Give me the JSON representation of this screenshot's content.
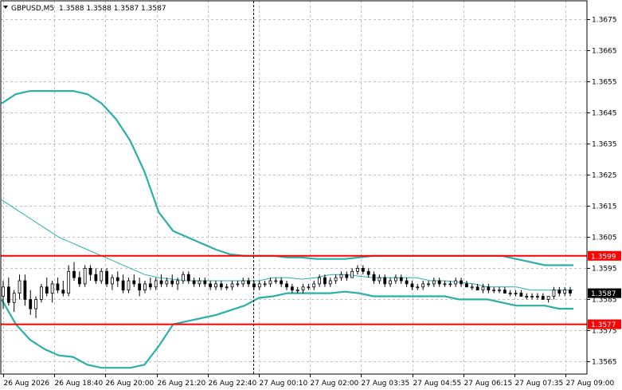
{
  "header": {
    "symbol": "GBPUSD,M5",
    "ohlc": "1.3588 1.3588 1.3587 1.3587",
    "menu_icon": "triangle-down-icon"
  },
  "colors": {
    "background": "#ffffff",
    "grid": "#c0c0c0",
    "band": "#2ab0a8",
    "middle": "#2ab0a8",
    "level": "#ff0000",
    "candle": "#000000",
    "price_tag": "#000000"
  },
  "chart_data": {
    "type": "candlestick",
    "title": "GBPUSD,M5",
    "y_ticks": [
      "1.3565",
      "1.3575",
      "1.3585",
      "1.3595",
      "1.3605",
      "1.3615",
      "1.3625",
      "1.3635",
      "1.3645",
      "1.3655",
      "1.3665",
      "1.3675"
    ],
    "ylim": [
      1.3561,
      1.3681
    ],
    "x_ticks": [
      "26 Aug 2026",
      "26 Aug 18:40",
      "26 Aug 20:00",
      "26 Aug 21:20",
      "26 Aug 22:40",
      "27 Aug 00:10",
      "27 Aug 02:00",
      "27 Aug 03:35",
      "27 Aug 04:55",
      "27 Aug 06:15",
      "27 Aug 07:35",
      "27 Aug 09:00"
    ],
    "grid": true,
    "horizontal_levels": [
      {
        "value": 1.3599,
        "label": "1.3599",
        "color": "#ff0000"
      },
      {
        "value": 1.3577,
        "label": "1.3577",
        "color": "#ff0000"
      }
    ],
    "current_price": {
      "value": 1.3587,
      "label": "1.3587"
    },
    "crosshair_x_fraction": 0.431,
    "upper_band": [
      1.3648,
      1.3651,
      1.3652,
      1.3652,
      1.3652,
      1.3652,
      1.3651,
      1.3648,
      1.3643,
      1.3636,
      1.3626,
      1.3613,
      1.3607,
      1.3605,
      1.3603,
      1.3601,
      1.35995,
      1.3599,
      1.3599,
      1.3599,
      1.35985,
      1.35985,
      1.3598,
      1.3598,
      1.3598,
      1.35985,
      1.3599,
      1.3599,
      1.3599,
      1.3599,
      1.3599,
      1.3599,
      1.3599,
      1.3599,
      1.3599,
      1.3599,
      1.3598,
      1.3597,
      1.3596,
      1.3596,
      1.3596
    ],
    "middle_band": [
      1.3617,
      1.3614,
      1.3611,
      1.3608,
      1.3605,
      1.3603,
      1.3601,
      1.3599,
      1.3597,
      1.3595,
      1.3593,
      1.3592,
      1.35915,
      1.3591,
      1.3591,
      1.3591,
      1.3591,
      1.3591,
      1.3591,
      1.3592,
      1.3592,
      1.35915,
      1.3592,
      1.3593,
      1.3593,
      1.35925,
      1.3592,
      1.3592,
      1.3592,
      1.3592,
      1.3591,
      1.3591,
      1.35905,
      1.359,
      1.3589,
      1.3589,
      1.3589,
      1.3588,
      1.3588,
      1.3588,
      1.3588
    ],
    "lower_band": [
      1.3585,
      1.3577,
      1.3572,
      1.3569,
      1.3567,
      1.35665,
      1.3564,
      1.3563,
      1.3563,
      1.3563,
      1.3564,
      1.357,
      1.3577,
      1.3578,
      1.3579,
      1.358,
      1.35815,
      1.3583,
      1.35855,
      1.3586,
      1.3587,
      1.3587,
      1.3587,
      1.3587,
      1.35875,
      1.3587,
      1.3586,
      1.3586,
      1.3586,
      1.3586,
      1.3586,
      1.3586,
      1.3585,
      1.3585,
      1.3585,
      1.3584,
      1.3583,
      1.3583,
      1.3583,
      1.3582,
      1.3582
    ],
    "candles": [
      [
        1.3586,
        1.3591,
        1.3582,
        1.3589
      ],
      [
        1.3589,
        1.3592,
        1.3583,
        1.3584
      ],
      [
        1.3584,
        1.3588,
        1.3581,
        1.3587
      ],
      [
        1.3587,
        1.3593,
        1.3585,
        1.3591
      ],
      [
        1.3591,
        1.3593,
        1.3583,
        1.3585
      ],
      [
        1.3585,
        1.3588,
        1.358,
        1.3582
      ],
      [
        1.3582,
        1.3586,
        1.3579,
        1.3585
      ],
      [
        1.3585,
        1.359,
        1.3584,
        1.3589
      ],
      [
        1.3589,
        1.3592,
        1.3586,
        1.3587
      ],
      [
        1.3587,
        1.3591,
        1.3584,
        1.359
      ],
      [
        1.359,
        1.3592,
        1.3587,
        1.3588
      ],
      [
        1.3588,
        1.3591,
        1.3586,
        1.3587
      ],
      [
        1.3587,
        1.3596,
        1.3586,
        1.3594
      ],
      [
        1.3594,
        1.3597,
        1.3591,
        1.3592
      ],
      [
        1.3592,
        1.3594,
        1.3589,
        1.359
      ],
      [
        1.359,
        1.3596,
        1.3589,
        1.3595
      ],
      [
        1.3595,
        1.3596,
        1.3591,
        1.3593
      ],
      [
        1.3593,
        1.3595,
        1.359,
        1.3591
      ],
      [
        1.3591,
        1.3595,
        1.359,
        1.3594
      ],
      [
        1.3594,
        1.3595,
        1.3589,
        1.359
      ],
      [
        1.359,
        1.3593,
        1.3588,
        1.3592
      ],
      [
        1.3592,
        1.3594,
        1.3589,
        1.3591
      ],
      [
        1.3591,
        1.3593,
        1.3587,
        1.3588
      ],
      [
        1.3588,
        1.3592,
        1.3587,
        1.3591
      ],
      [
        1.3591,
        1.3593,
        1.3589,
        1.359
      ],
      [
        1.359,
        1.3592,
        1.3586,
        1.3588
      ],
      [
        1.3588,
        1.3591,
        1.3587,
        1.359
      ],
      [
        1.359,
        1.3592,
        1.3588,
        1.3589
      ],
      [
        1.3589,
        1.3592,
        1.3588,
        1.3591
      ],
      [
        1.3591,
        1.3593,
        1.3589,
        1.359
      ],
      [
        1.359,
        1.3592,
        1.3589,
        1.3591
      ],
      [
        1.3591,
        1.3593,
        1.3589,
        1.359
      ],
      [
        1.359,
        1.3592,
        1.3588,
        1.3591
      ],
      [
        1.3591,
        1.3594,
        1.359,
        1.3593
      ],
      [
        1.3593,
        1.3594,
        1.359,
        1.3591
      ],
      [
        1.3591,
        1.3592,
        1.3589,
        1.359
      ],
      [
        1.359,
        1.3592,
        1.3589,
        1.3591
      ],
      [
        1.3591,
        1.3592,
        1.3589,
        1.359
      ],
      [
        1.359,
        1.3591,
        1.3588,
        1.3589
      ],
      [
        1.3589,
        1.3591,
        1.3588,
        1.359
      ],
      [
        1.359,
        1.3591,
        1.3588,
        1.3589
      ],
      [
        1.3589,
        1.359,
        1.3588,
        1.3589
      ],
      [
        1.3589,
        1.3591,
        1.3588,
        1.359
      ],
      [
        1.359,
        1.3591,
        1.3589,
        1.359
      ],
      [
        1.359,
        1.3592,
        1.3589,
        1.3591
      ],
      [
        1.3591,
        1.3592,
        1.3589,
        1.359
      ],
      [
        1.359,
        1.3591,
        1.3588,
        1.3589
      ],
      [
        1.3589,
        1.3591,
        1.3588,
        1.359
      ],
      [
        1.359,
        1.3591,
        1.3589,
        1.359
      ],
      [
        1.359,
        1.3592,
        1.3589,
        1.3591
      ],
      [
        1.3591,
        1.3592,
        1.359,
        1.3591
      ],
      [
        1.3591,
        1.3592,
        1.3589,
        1.359
      ],
      [
        1.359,
        1.3591,
        1.3588,
        1.3589
      ],
      [
        1.3589,
        1.359,
        1.3587,
        1.3588
      ],
      [
        1.3588,
        1.3589,
        1.3587,
        1.3588
      ],
      [
        1.3588,
        1.359,
        1.3587,
        1.3589
      ],
      [
        1.3589,
        1.359,
        1.3588,
        1.3589
      ],
      [
        1.3589,
        1.3591,
        1.3588,
        1.359
      ],
      [
        1.359,
        1.3593,
        1.3589,
        1.3592
      ],
      [
        1.3592,
        1.3593,
        1.3589,
        1.359
      ],
      [
        1.359,
        1.3592,
        1.3589,
        1.3591
      ],
      [
        1.3591,
        1.3593,
        1.359,
        1.3592
      ],
      [
        1.3592,
        1.3594,
        1.3591,
        1.3593
      ],
      [
        1.3593,
        1.3594,
        1.3591,
        1.3592
      ],
      [
        1.3592,
        1.3595,
        1.3592,
        1.3594
      ],
      [
        1.3594,
        1.3596,
        1.3593,
        1.3595
      ],
      [
        1.3595,
        1.3596,
        1.3593,
        1.3594
      ],
      [
        1.3594,
        1.3595,
        1.3592,
        1.3593
      ],
      [
        1.3593,
        1.3594,
        1.359,
        1.3591
      ],
      [
        1.3591,
        1.3593,
        1.359,
        1.3592
      ],
      [
        1.3592,
        1.3593,
        1.3589,
        1.359
      ],
      [
        1.359,
        1.3592,
        1.3589,
        1.3591
      ],
      [
        1.3591,
        1.3593,
        1.359,
        1.3592
      ],
      [
        1.3592,
        1.3593,
        1.359,
        1.3591
      ],
      [
        1.3591,
        1.3592,
        1.3589,
        1.359
      ],
      [
        1.359,
        1.3591,
        1.3588,
        1.3589
      ],
      [
        1.3589,
        1.359,
        1.3588,
        1.3589
      ],
      [
        1.3589,
        1.3591,
        1.3588,
        1.359
      ],
      [
        1.359,
        1.3591,
        1.3589,
        1.359
      ],
      [
        1.359,
        1.3592,
        1.3589,
        1.3591
      ],
      [
        1.3591,
        1.3592,
        1.3589,
        1.359
      ],
      [
        1.359,
        1.3591,
        1.3589,
        1.359
      ],
      [
        1.359,
        1.3591,
        1.3589,
        1.359
      ],
      [
        1.359,
        1.3592,
        1.3589,
        1.3591
      ],
      [
        1.3591,
        1.3592,
        1.3589,
        1.359
      ],
      [
        1.359,
        1.3591,
        1.3589,
        1.3589
      ],
      [
        1.3589,
        1.359,
        1.3588,
        1.3589
      ],
      [
        1.3589,
        1.359,
        1.3588,
        1.3588
      ],
      [
        1.3588,
        1.359,
        1.3587,
        1.3589
      ],
      [
        1.3589,
        1.359,
        1.3587,
        1.3588
      ],
      [
        1.3588,
        1.3589,
        1.3587,
        1.3588
      ],
      [
        1.3588,
        1.3589,
        1.3587,
        1.3588
      ],
      [
        1.3588,
        1.3589,
        1.3587,
        1.3587
      ],
      [
        1.3587,
        1.3588,
        1.3586,
        1.3587
      ],
      [
        1.3587,
        1.3588,
        1.3586,
        1.3587
      ],
      [
        1.3587,
        1.3588,
        1.3586,
        1.3586
      ],
      [
        1.3586,
        1.3587,
        1.3585,
        1.3586
      ],
      [
        1.3586,
        1.3587,
        1.3585,
        1.3586
      ],
      [
        1.3586,
        1.3587,
        1.3585,
        1.3586
      ],
      [
        1.3586,
        1.3587,
        1.3585,
        1.3585
      ],
      [
        1.3585,
        1.3586,
        1.3584,
        1.3586
      ],
      [
        1.3586,
        1.3589,
        1.3585,
        1.3588
      ],
      [
        1.3588,
        1.3589,
        1.3586,
        1.3587
      ],
      [
        1.3587,
        1.3589,
        1.3586,
        1.3588
      ],
      [
        1.3588,
        1.3589,
        1.3586,
        1.3587
      ]
    ]
  }
}
